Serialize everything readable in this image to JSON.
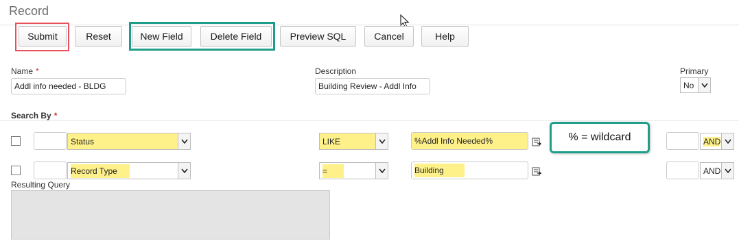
{
  "title": "Record",
  "toolbar": {
    "submit": "Submit",
    "reset": "Reset",
    "new_field": "New Field",
    "delete_field": "Delete Field",
    "preview_sql": "Preview SQL",
    "cancel": "Cancel",
    "help": "Help"
  },
  "form": {
    "name_label": "Name",
    "name_required": "*",
    "name_value": "Addl info needed - BLDG",
    "description_label": "Description",
    "description_value": "Building Review - Addl Info",
    "primary_label": "Primary",
    "primary_value": "No"
  },
  "search_by": {
    "label": "Search By",
    "required": "*",
    "rows": [
      {
        "field": "Status",
        "operator": "LIKE",
        "value": "%Addl Info Needed%",
        "conjunction": "AND"
      },
      {
        "field": "Record Type",
        "operator": "=",
        "value": "Building",
        "conjunction": "AND"
      }
    ]
  },
  "resulting_query_label": "Resulting Query",
  "callout": "% = wildcard",
  "colors": {
    "highlight_red": "#e8505b",
    "highlight_teal": "#1e9e8a",
    "highlight_yellow": "#fff18a"
  },
  "icons": {
    "cursor": "mouse-pointer-icon",
    "lookup": "lookup-icon",
    "dropdown": "chevron-down-icon"
  }
}
